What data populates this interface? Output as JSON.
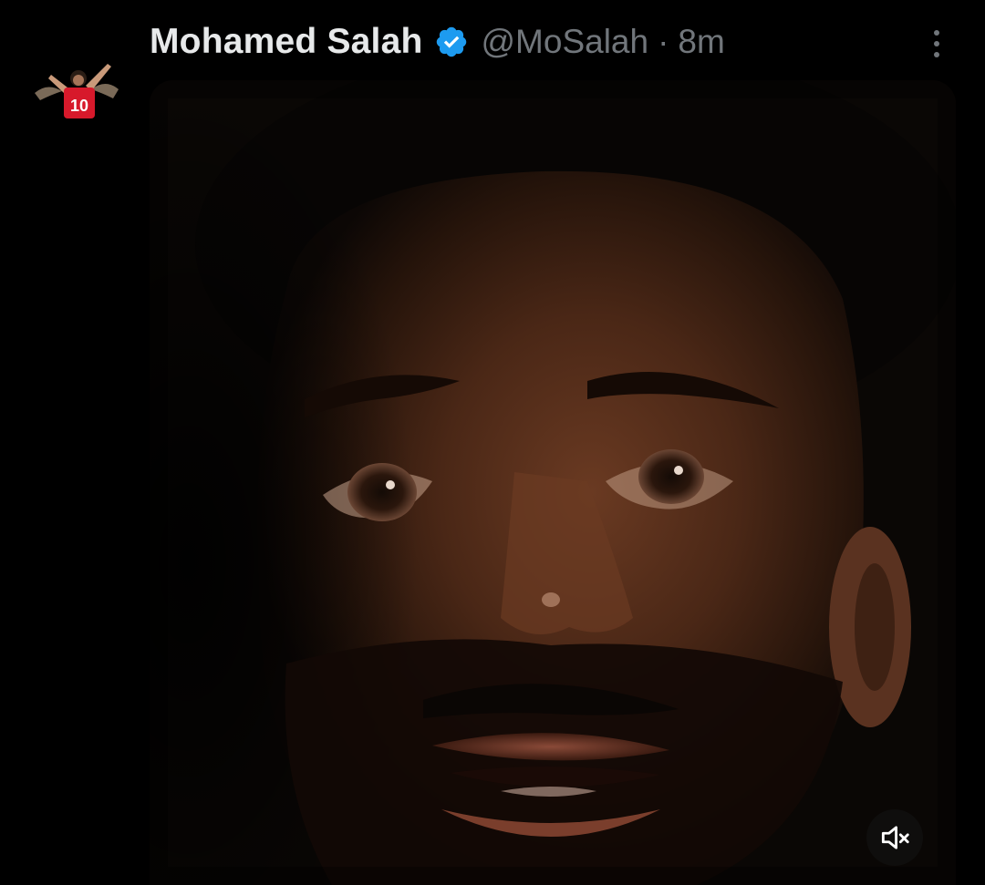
{
  "tweet": {
    "author": {
      "display_name": "Mohamed Salah",
      "handle": "@MoSalah",
      "verified": true,
      "avatar_icon": "player-celebration-avatar"
    },
    "separator": "·",
    "time": "8m",
    "media": {
      "type": "video",
      "subject": "close-up-face",
      "muted": true,
      "mute_icon": "speaker-muted-icon"
    },
    "more_icon": "more-vertical-icon"
  },
  "colors": {
    "background": "#000000",
    "name": "#e7e9ea",
    "secondary": "#71767b",
    "verified_badge": "#1d9bf0"
  }
}
